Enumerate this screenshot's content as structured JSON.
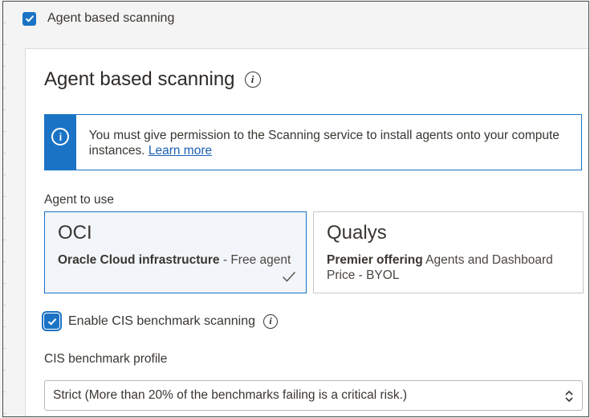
{
  "top_checkbox": {
    "label": "Agent based scanning",
    "checked": true
  },
  "panel": {
    "title": "Agent based scanning",
    "title_info_icon": "info-icon"
  },
  "banner": {
    "icon": "info-icon",
    "text": "You must give permission to the Scanning service to install agents onto your compute instances.",
    "link_text": "Learn more"
  },
  "agent_section": {
    "label": "Agent to use",
    "options": [
      {
        "name": "OCI",
        "desc_bold": "Oracle Cloud infrastructure",
        "desc_rest": " - Free agent",
        "selected": true
      },
      {
        "name": "Qualys",
        "desc_bold": "Premier offering",
        "desc_rest": " Agents and Dashboard Price - BYOL",
        "selected": false
      }
    ]
  },
  "cis": {
    "checkbox_label": "Enable CIS benchmark scanning",
    "checked": true,
    "profile_label": "CIS benchmark profile",
    "profile_value": "Strict (More than 20% of the benchmarks failing is a critical risk.)"
  },
  "colors": {
    "accent": "#1a73c5",
    "link": "#1a5fb4",
    "selected_bg": "#f2f6fb"
  }
}
